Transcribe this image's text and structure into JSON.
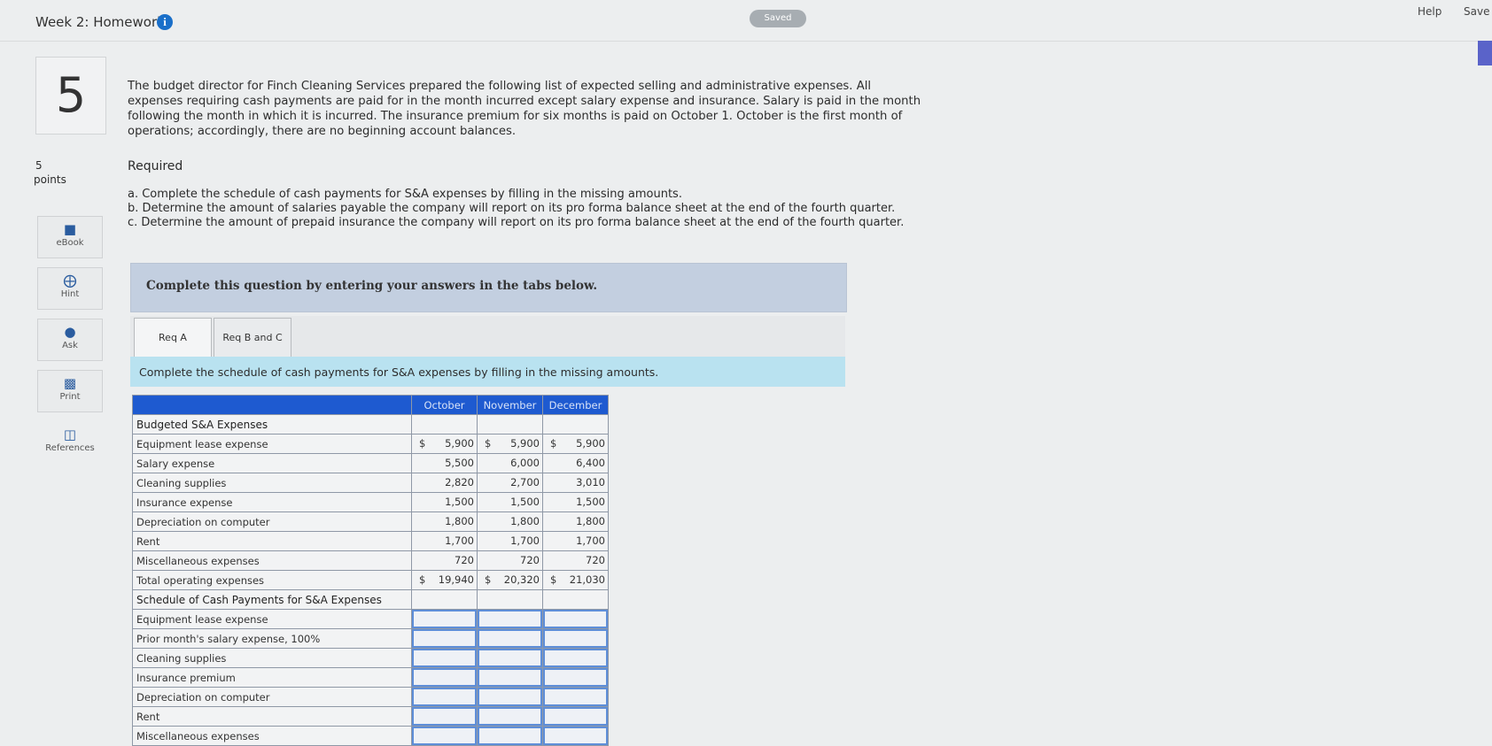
{
  "header": {
    "title": "Week 2: Homework",
    "saved_label": "Saved",
    "help_label": "Help",
    "save_label": "Save"
  },
  "question": {
    "number": "5",
    "points_value": "5",
    "points_label": "points",
    "text": "The budget director for Finch Cleaning Services prepared the following list of expected selling and administrative expenses. All expenses requiring cash payments are paid for in the month incurred except salary expense and insurance. Salary is paid in the month following the month in which it is incurred. The insurance premium for six months is paid on October 1. October is the first month of operations; accordingly, there are no beginning account balances.",
    "required_label": "Required",
    "requirements": [
      "a. Complete the schedule of cash payments for S&A expenses by filling in the missing amounts.",
      "b. Determine the amount of salaries payable the company will report on its pro forma balance sheet at the end of the fourth quarter.",
      "c. Determine the amount of prepaid insurance the company will report on its pro forma balance sheet at the end of the fourth quarter."
    ]
  },
  "sidebar": {
    "items": [
      {
        "label": "eBook",
        "icon": "book-icon"
      },
      {
        "label": "Hint",
        "icon": "lifebuoy-icon"
      },
      {
        "label": "Ask",
        "icon": "speech-bubble-icon"
      },
      {
        "label": "Print",
        "icon": "printer-icon"
      },
      {
        "label": "References",
        "icon": "document-icon"
      }
    ]
  },
  "instructions": "Complete this question by entering your answers in the tabs below.",
  "tabs": [
    {
      "label": "Req A",
      "active": true
    },
    {
      "label": "Req B and C",
      "active": false
    }
  ],
  "task_text": "Complete the schedule of cash payments for S&A expenses by filling in the missing amounts.",
  "schedule": {
    "columns": [
      "October",
      "November",
      "December"
    ],
    "budget_section": "Budgeted S&A Expenses",
    "budget_rows": [
      {
        "label": "Equipment lease expense",
        "values": [
          "5,900",
          "5,900",
          "5,900"
        ],
        "currency": true
      },
      {
        "label": "Salary expense",
        "values": [
          "5,500",
          "6,000",
          "6,400"
        ],
        "currency": false
      },
      {
        "label": "Cleaning supplies",
        "values": [
          "2,820",
          "2,700",
          "3,010"
        ],
        "currency": false
      },
      {
        "label": "Insurance expense",
        "values": [
          "1,500",
          "1,500",
          "1,500"
        ],
        "currency": false
      },
      {
        "label": "Depreciation on computer",
        "values": [
          "1,800",
          "1,800",
          "1,800"
        ],
        "currency": false
      },
      {
        "label": "Rent",
        "values": [
          "1,700",
          "1,700",
          "1,700"
        ],
        "currency": false
      },
      {
        "label": "Miscellaneous expenses",
        "values": [
          "720",
          "720",
          "720"
        ],
        "currency": false
      },
      {
        "label": "Total operating expenses",
        "values": [
          "19,940",
          "20,320",
          "21,030"
        ],
        "currency": true
      }
    ],
    "cash_section": "Schedule of Cash Payments for S&A Expenses",
    "cash_rows": [
      "Equipment lease expense",
      "Prior month's salary expense, 100%",
      "Cleaning supplies",
      "Insurance premium",
      "Depreciation on computer",
      "Rent",
      "Miscellaneous expenses"
    ],
    "currency_symbol": "$"
  }
}
